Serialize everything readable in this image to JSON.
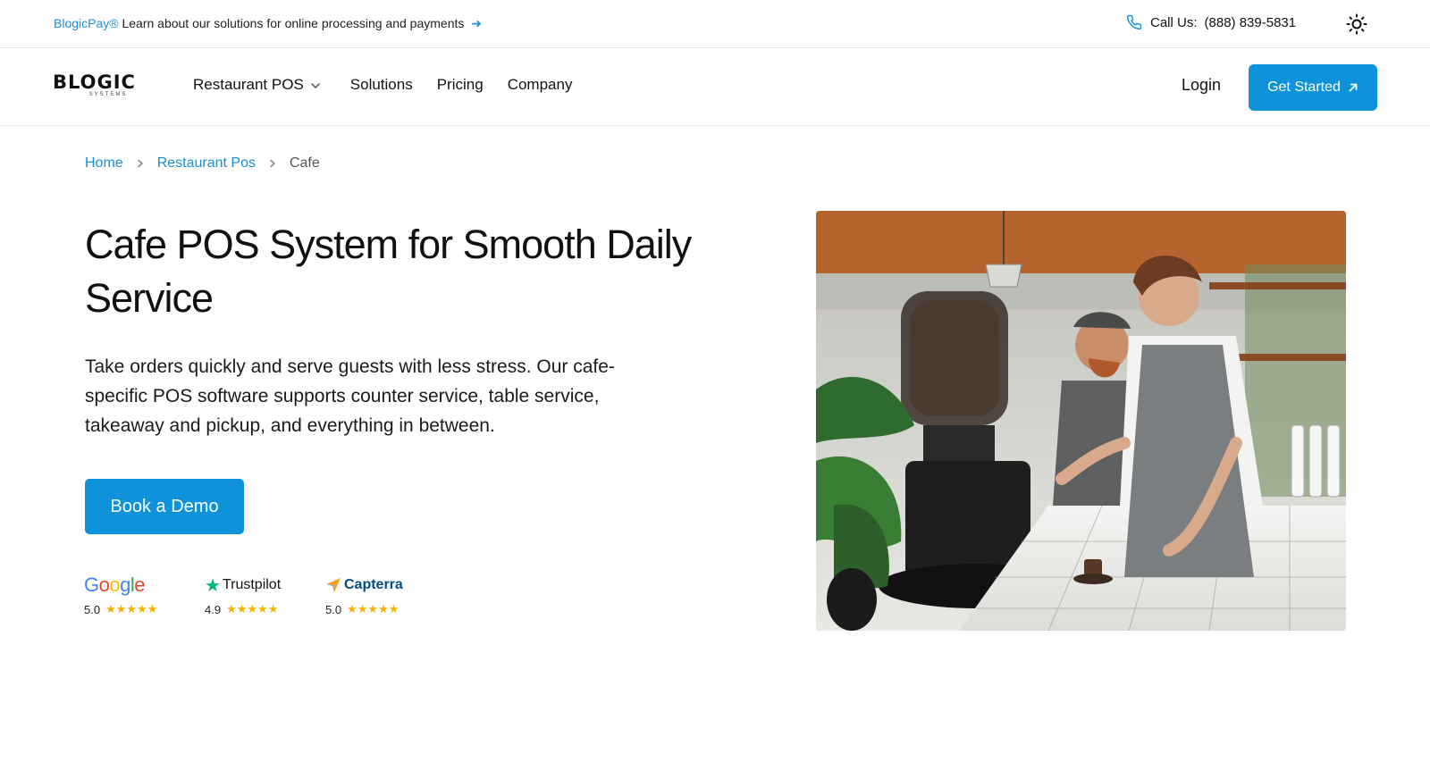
{
  "topbar": {
    "brand": "BlogicPay®",
    "announcement": "Learn about our solutions for online processing and payments",
    "call_label": "Call Us:",
    "phone": "(888) 839-5831"
  },
  "nav": {
    "logo": "BLOGIC",
    "logo_sub": "SYSTEMS",
    "items": [
      {
        "label": "Restaurant POS"
      },
      {
        "label": "Solutions"
      },
      {
        "label": "Pricing"
      },
      {
        "label": "Company"
      }
    ],
    "login": "Login",
    "cta": "Get Started"
  },
  "breadcrumb": {
    "home": "Home",
    "section": "Restaurant Pos",
    "current": "Cafe"
  },
  "hero": {
    "title": "Cafe POS System for Smooth Daily Service",
    "description": "Take orders quickly and serve guests with less stress. Our cafe-specific POS software supports counter service, table service, takeaway and pickup, and everything in between.",
    "cta": "Book a Demo"
  },
  "ratings": [
    {
      "source": "Google",
      "score": "5.0",
      "stars": "★★★★★"
    },
    {
      "source": "Trustpilot",
      "score": "4.9",
      "stars": "★★★★★"
    },
    {
      "source": "Capterra",
      "score": "5.0",
      "stars": "★★★★★"
    }
  ],
  "colors": {
    "accent": "#0e93db",
    "link": "#1a8fd6",
    "star": "#f5b301",
    "trustpilot": "#00b67a"
  },
  "icons": {
    "phone": "phone-icon",
    "theme": "sun-icon",
    "dropdown": "chevron-down-icon",
    "external": "arrow-up-right-icon",
    "separator": "chevron-right-icon"
  }
}
